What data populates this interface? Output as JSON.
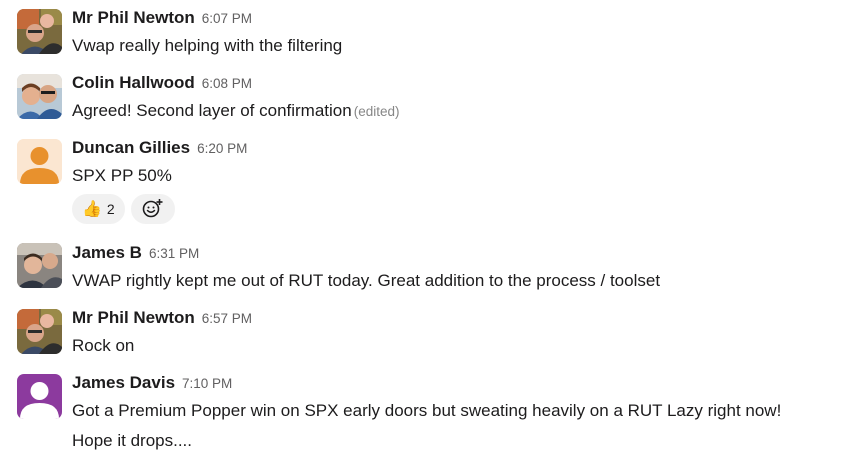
{
  "messages": [
    {
      "author": "Mr Phil Newton",
      "time": "6:07 PM",
      "text": "Vwap really helping with the filtering",
      "avatar_icon": "user-photo-avatar"
    },
    {
      "author": "Colin Hallwood",
      "time": "6:08 PM",
      "text": "Agreed! Second layer of confirmation",
      "edited": "(edited)",
      "avatar_icon": "user-photo-avatar"
    },
    {
      "author": "Duncan Gillies",
      "time": "6:20 PM",
      "text": "SPX PP 50%",
      "avatar_icon": "default-user-avatar",
      "avatar_color": "#e8912d",
      "reactions": [
        {
          "emoji": "👍",
          "icon": "thumbs-up-icon",
          "count": "2"
        }
      ]
    },
    {
      "author": "James B",
      "time": "6:31 PM",
      "text": "VWAP rightly kept me out of RUT today. Great addition to the process / toolset",
      "avatar_icon": "user-photo-avatar"
    },
    {
      "author": "Mr Phil Newton",
      "time": "6:57 PM",
      "text": "Rock on",
      "avatar_icon": "user-photo-avatar"
    },
    {
      "author": "James Davis",
      "time": "7:10 PM",
      "text": "Got a Premium Popper win on SPX early doors but sweating heavily on a RUT Lazy right now! Hope it drops....",
      "avatar_icon": "default-user-avatar",
      "avatar_color": "#8c3a9e"
    }
  ],
  "add_reaction_icon": "add-reaction-icon"
}
